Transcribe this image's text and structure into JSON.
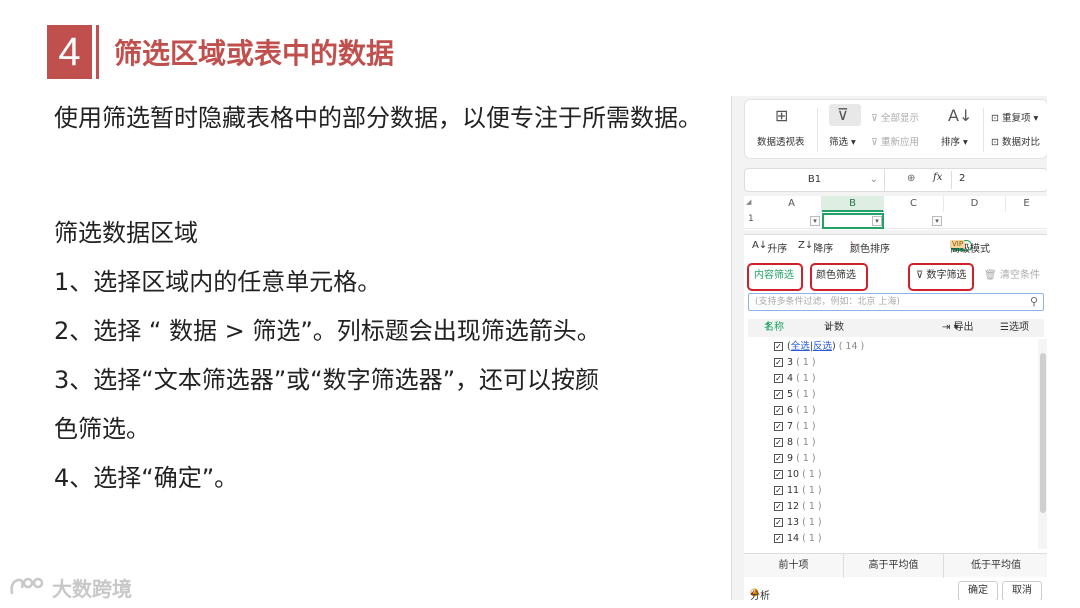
{
  "slide": {
    "number": "4",
    "title": "筛选区域或表中的数据",
    "intro": "使用筛选暂时隐藏表格中的部分数据，以便专注于所需数据。",
    "section_heading": "筛选数据区域",
    "steps": [
      "1、选择区域内的任意单元格。",
      "2、选择 “ 数据 > 筛选”。列标题会出现筛选箭头。",
      "3、选择“文本筛选器”或“数字筛选器”，还可以按颜",
      "色筛选。",
      "4、选择“确定”。"
    ],
    "logo_text": "大数跨境",
    "accent_color": "#c0504d"
  },
  "ribbon": {
    "pivot_label": "数据透视表",
    "filter_label": "筛选",
    "show_all_label": "全部显示",
    "reapply_label": "重新应用",
    "sort_label": "排序",
    "dup_label": "重复项",
    "compare_label": "数据对比"
  },
  "formula_bar": {
    "cell_ref": "B1",
    "fx": "fx",
    "value": "2"
  },
  "sheet": {
    "columns": [
      "A",
      "B",
      "C",
      "D",
      "E"
    ],
    "row_number": "1"
  },
  "filter_panel": {
    "asc_label": "升序",
    "desc_label": "降序",
    "color_sort_label": "颜色排序",
    "advanced_label": "高级模式",
    "toggle_text": "开",
    "vip_text": "VIP",
    "tabs": {
      "content": "内容筛选",
      "color": "颜色筛选",
      "number": "数字筛选",
      "clear": "清空条件"
    },
    "search_placeholder": "(支持多条件过滤，例如：北京 上海)",
    "list_header": {
      "name": "名称",
      "count": "计数",
      "export": "导出",
      "options": "选项"
    },
    "select_all": "全选",
    "invert": "反选",
    "total_count": "( 14 )",
    "items": [
      {
        "label": "3",
        "count": "( 1 )"
      },
      {
        "label": "4",
        "count": "( 1 )"
      },
      {
        "label": "5",
        "count": "( 1 )"
      },
      {
        "label": "6",
        "count": "( 1 )"
      },
      {
        "label": "7",
        "count": "( 1 )"
      },
      {
        "label": "8",
        "count": "( 1 )"
      },
      {
        "label": "9",
        "count": "( 1 )"
      },
      {
        "label": "10",
        "count": "( 1 )"
      },
      {
        "label": "11",
        "count": "( 1 )"
      },
      {
        "label": "12",
        "count": "( 1 )"
      },
      {
        "label": "13",
        "count": "( 1 )"
      },
      {
        "label": "14",
        "count": "( 1 )"
      }
    ],
    "bottom_tabs": [
      "前十项",
      "高于平均值",
      "低于平均值"
    ],
    "analysis_label": "分析",
    "ok_label": "确定",
    "cancel_label": "取消",
    "highlight_color": "#d0212a"
  }
}
